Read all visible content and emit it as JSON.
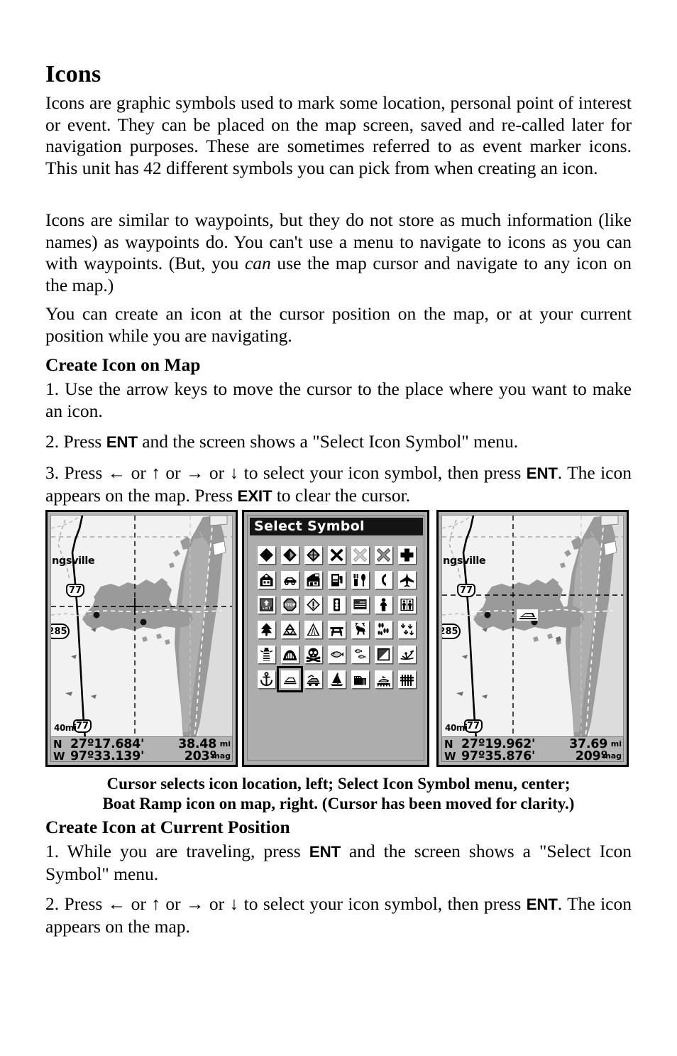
{
  "document": {
    "title": "Icons",
    "paragraphs": [
      "Icons are graphic symbols used to mark some location, personal point of interest or event. They can be placed on the map screen, saved and re-called later for navigation purposes. These are sometimes referred to as event marker icons. This unit has 42 different symbols you can pick from when creating an icon.",
      "You can create an icon at the cursor position on the map, or at your current position while you are navigating."
    ],
    "para2": {
      "before_italic": "Icons are similar to waypoints, but they do not store as much information (like names) as waypoints do. You can't use a menu to navigate to icons as you can with waypoints. (But, you ",
      "italic": "can",
      "after_italic": " use the map cursor and navigate to any icon on the map.)"
    },
    "sections": [
      {
        "heading": "Create Icon on Map",
        "steps": [
          {
            "a": "1. Use the arrow keys to move the cursor to the place where you want to make an icon."
          },
          {
            "a": "2. Press ",
            "kbd1": "ENT",
            "b": " and the screen shows a \"Select Icon Symbol\" menu."
          },
          {
            "a": "3. Press ← or ↑ or → or ↓ to select your icon symbol, then press ",
            "kbd1": "ENT",
            "b": ". The icon appears on the map. Press ",
            "kbd2": "EXIT",
            "c": " to clear the cursor."
          }
        ]
      },
      {
        "heading": "Create Icon at Current Position",
        "steps": [
          {
            "a": "1. While you are traveling, press ",
            "kbd1": "ENT",
            "b": " and the screen shows a \"Select Icon Symbol\" menu."
          },
          {
            "a": "2. Press ← or ↑ or → or ↓ to select your icon symbol, then press ",
            "kbd1": "ENT",
            "b": ". The icon appears on the map."
          }
        ]
      }
    ],
    "figure_caption_line1": "Cursor selects icon location, left; Select Icon Symbol menu, center;",
    "figure_caption_line2": "Boat Ramp icon on map, right. (Cursor has been moved for clarity.)"
  },
  "figure": {
    "left_screen": {
      "name": "map-with-cursor",
      "city_label": "ngsville",
      "scale_label": "40mi",
      "highway_shield_upper": "77",
      "highway_shield_lower": "77",
      "highway_shield_side": "285",
      "data_bar": {
        "lat_hemisphere": "N",
        "latitude": "27º17.684'",
        "lon_hemisphere": "W",
        "longitude": "97º33.139'",
        "distance_value": "38.48",
        "distance_unit": "mi",
        "bearing_value": "203º",
        "bearing_unit": "mag"
      }
    },
    "center_screen": {
      "name": "select-symbol-menu",
      "menu_title": "Select Symbol",
      "selected_index": 36,
      "symbols": [
        "waypoint-diamond-filled",
        "waypoint-diamond-half",
        "waypoint-diamond-outline",
        "cross-x-bold",
        "cross-x-light",
        "cross-x-medium",
        "first-aid-cross",
        "house",
        "car",
        "store",
        "fuel-pump",
        "restaurant",
        "telephone",
        "airport",
        "exit-sign",
        "stop-sign",
        "caution-sign",
        "traffic-light",
        "flag",
        "person",
        "restrooms",
        "tree",
        "mountains",
        "tent",
        "picnic-table",
        "deer",
        "animal-tracks",
        "duck-tracks",
        "lighthouse",
        "bridge",
        "danger-skull",
        "fish-large",
        "fish-small",
        "square-split",
        "water-ski",
        "anchor",
        "boat-ramp",
        "boat-trailer",
        "sailboat",
        "dam",
        "marina",
        "pier"
      ]
    },
    "right_screen": {
      "name": "map-with-boat-ramp-icon",
      "city_label": "ngsville",
      "scale_label": "40mi",
      "highway_shield_upper": "77",
      "highway_shield_lower": "77",
      "highway_shield_side": "285",
      "placed_icon": "boat-ramp",
      "data_bar": {
        "lat_hemisphere": "N",
        "latitude": "27º19.962'",
        "lon_hemisphere": "W",
        "longitude": "97º35.876'",
        "distance_value": "37.69",
        "distance_unit": "mi",
        "bearing_value": "209º",
        "bearing_unit": "mag"
      }
    }
  },
  "colors": {
    "page_background": "#ffffff",
    "text": "#000000",
    "screen_bezel": "#000000",
    "screen_chrome": "#b4b4b4",
    "map_background": "#f2f2f2",
    "water_fill": "#9a9a9a",
    "land_shade": "#d0d0d0",
    "menu_title_bar": "#141414"
  }
}
